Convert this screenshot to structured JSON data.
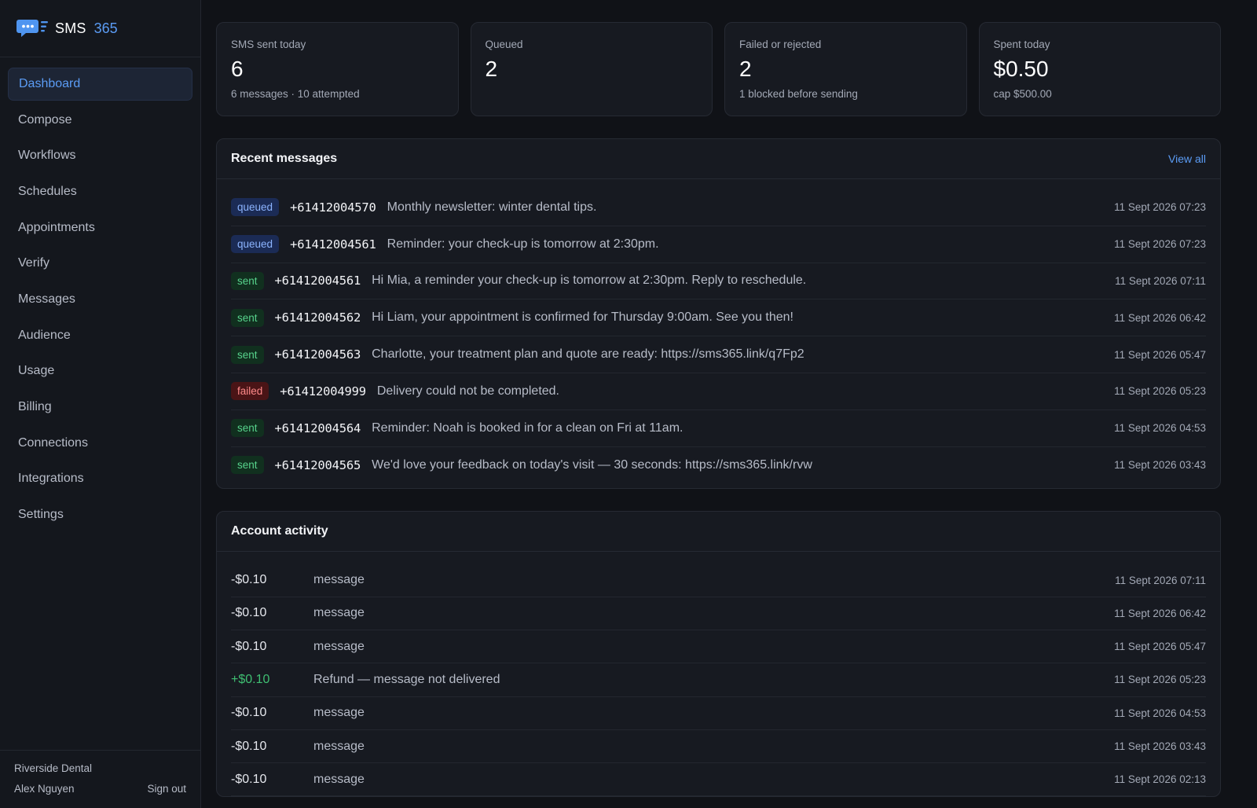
{
  "brand": {
    "name": "SMS",
    "accent": "365",
    "logo_icon": "chat-bubble-icon"
  },
  "nav": {
    "items": [
      {
        "label": "Dashboard",
        "active": true
      },
      {
        "label": "Compose"
      },
      {
        "label": "Workflows"
      },
      {
        "label": "Schedules"
      },
      {
        "label": "Appointments"
      },
      {
        "label": "Verify"
      },
      {
        "label": "Messages"
      },
      {
        "label": "Audience"
      },
      {
        "label": "Usage"
      },
      {
        "label": "Billing"
      },
      {
        "label": "Connections"
      },
      {
        "label": "Integrations"
      },
      {
        "label": "Settings"
      }
    ]
  },
  "account": {
    "org": "Riverside Dental",
    "user": "Alex Nguyen",
    "sign_out": "Sign out"
  },
  "stats": [
    {
      "label": "SMS sent today",
      "value": "6",
      "sub": "6 messages · 10 attempted"
    },
    {
      "label": "Queued",
      "value": "2",
      "sub": ""
    },
    {
      "label": "Failed or rejected",
      "value": "2",
      "sub": "1 blocked before sending"
    },
    {
      "label": "Spent today",
      "value": "$0.50",
      "sub": "cap $500.00"
    }
  ],
  "recent": {
    "title": "Recent messages",
    "view_all": "View all",
    "rows": [
      {
        "status": "queued",
        "phone": "+61412004570",
        "text": "Monthly newsletter: winter dental tips.",
        "time": "11 Sept 2026 07:23"
      },
      {
        "status": "queued",
        "phone": "+61412004561",
        "text": "Reminder: your check-up is tomorrow at 2:30pm.",
        "time": "11 Sept 2026 07:23"
      },
      {
        "status": "sent",
        "phone": "+61412004561",
        "text": "Hi Mia, a reminder your check-up is tomorrow at 2:30pm. Reply to reschedule.",
        "time": "11 Sept 2026 07:11"
      },
      {
        "status": "sent",
        "phone": "+61412004562",
        "text": "Hi Liam, your appointment is confirmed for Thursday 9:00am. See you then!",
        "time": "11 Sept 2026 06:42"
      },
      {
        "status": "sent",
        "phone": "+61412004563",
        "text": "Charlotte, your treatment plan and quote are ready: https://sms365.link/q7Fp2",
        "time": "11 Sept 2026 05:47"
      },
      {
        "status": "failed",
        "phone": "+61412004999",
        "text": "Delivery could not be completed.",
        "time": "11 Sept 2026 05:23"
      },
      {
        "status": "sent",
        "phone": "+61412004564",
        "text": "Reminder: Noah is booked in for a clean on Fri at 11am.",
        "time": "11 Sept 2026 04:53"
      },
      {
        "status": "sent",
        "phone": "+61412004565",
        "text": "We'd love your feedback on today's visit — 30 seconds: https://sms365.link/rvw",
        "time": "11 Sept 2026 03:43"
      }
    ]
  },
  "activity": {
    "title": "Account activity",
    "rows": [
      {
        "amount": "-$0.10",
        "desc": "message",
        "time": "11 Sept 2026 07:11"
      },
      {
        "amount": "-$0.10",
        "desc": "message",
        "time": "11 Sept 2026 06:42"
      },
      {
        "amount": "-$0.10",
        "desc": "message",
        "time": "11 Sept 2026 05:47"
      },
      {
        "amount": "+$0.10",
        "desc": "Refund — message not delivered",
        "time": "11 Sept 2026 05:23",
        "positive": true
      },
      {
        "amount": "-$0.10",
        "desc": "message",
        "time": "11 Sept 2026 04:53"
      },
      {
        "amount": "-$0.10",
        "desc": "message",
        "time": "11 Sept 2026 03:43"
      },
      {
        "amount": "-$0.10",
        "desc": "message",
        "time": "11 Sept 2026 02:13"
      }
    ]
  },
  "colors": {
    "accent": "#5b9cf5",
    "queued": "#8cb4ff",
    "sent": "#57d38c",
    "failed": "#ff8a8a",
    "positive": "#3fbf72"
  }
}
